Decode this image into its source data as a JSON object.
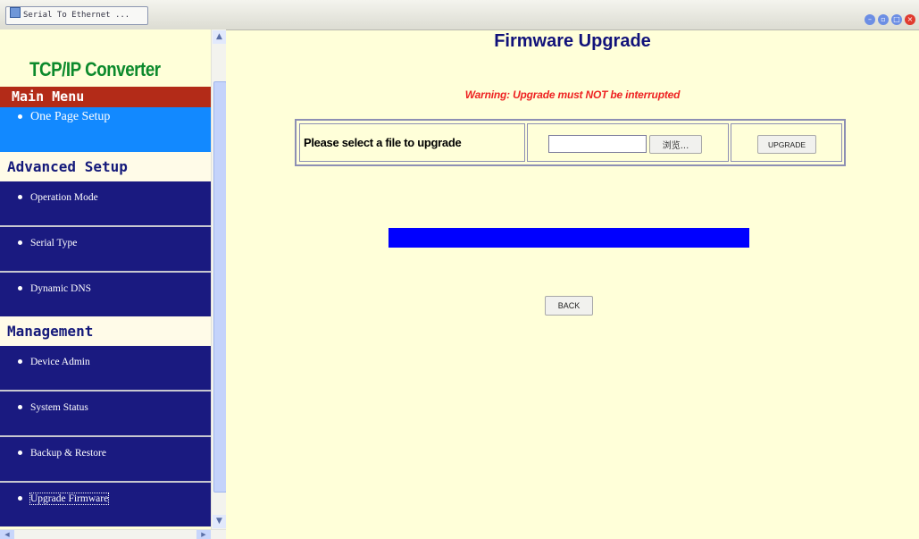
{
  "window": {
    "tab_title": "Serial To Ethernet ..."
  },
  "sidebar": {
    "brand": "TCP/IP Converter",
    "main_menu_header": "Main Menu",
    "one_page_setup": "One Page Setup",
    "advanced_header": "Advanced Setup",
    "advanced_items": [
      "Operation Mode",
      "Serial Type",
      "Dynamic DNS"
    ],
    "management_header": "Management",
    "management_items": [
      "Device Admin",
      "System Status",
      "Backup & Restore",
      "Upgrade Firmware"
    ],
    "selected_item": "Upgrade Firmware"
  },
  "main": {
    "title": "Firmware Upgrade",
    "warning": "Warning: Upgrade must NOT be interrupted",
    "file_prompt": "Please select a file to upgrade",
    "file_value": "",
    "browse_label": "浏览...",
    "upgrade_label": "UPGRADE",
    "back_label": "BACK",
    "progress_fraction": 1.0
  },
  "colors": {
    "background": "#ffffd9",
    "menu_header": "#b32b18",
    "active_item": "#1289ff",
    "menu_item": "#1a1a80",
    "brand": "#0c8a2c",
    "title": "#11127a",
    "warning": "#ee2222",
    "progress": "#0000ff"
  }
}
